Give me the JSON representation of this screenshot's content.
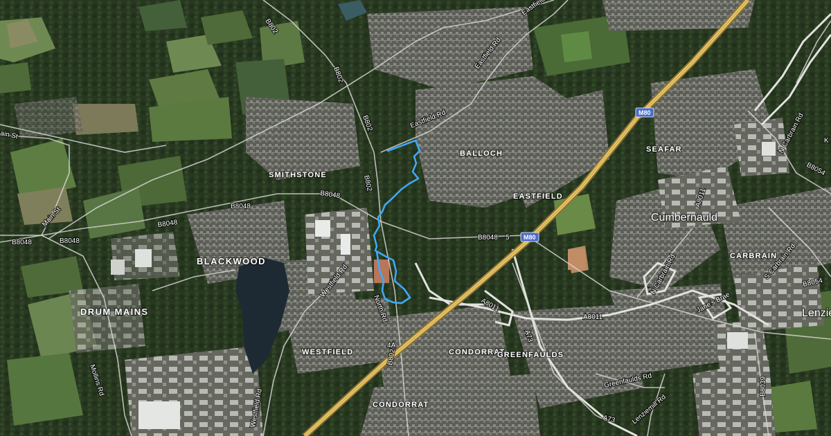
{
  "map": {
    "type": "satellite",
    "colors": {
      "background": "#2f3d27",
      "field": "#4f6b39",
      "field_light": "#6e8a52",
      "forest": "#22321c",
      "urban": "#6f706a",
      "motorway": "#e8c568",
      "road": "#d6d6d2",
      "route": "#3fa9f5",
      "water": "#1e2a33"
    },
    "places": [
      {
        "id": "balloch",
        "label": "BALLOCH"
      },
      {
        "id": "smithstone",
        "label": "SMITHSTONE"
      },
      {
        "id": "eastfield",
        "label": "EASTFIELD"
      },
      {
        "id": "seafar",
        "label": "SEAFAR"
      },
      {
        "id": "blackwood",
        "label": "BLACKWOOD"
      },
      {
        "id": "drum_mains",
        "label": "DRUM MAINS"
      },
      {
        "id": "westfield",
        "label": "WESTFIELD"
      },
      {
        "id": "condorrat_a",
        "label": "CONDORRAT"
      },
      {
        "id": "condorrat_b",
        "label": "CONDORRAT"
      },
      {
        "id": "greenfaulds",
        "label": "GREENFAULDS"
      },
      {
        "id": "carbrain",
        "label": "CARBRAIN"
      },
      {
        "id": "cumbernauld",
        "label": "Cumbernauld"
      },
      {
        "id": "lenzie",
        "label": "Lenzie"
      }
    ],
    "roads": [
      {
        "id": "b802_top",
        "label": "B802"
      },
      {
        "id": "b802_a",
        "label": "B802"
      },
      {
        "id": "b802_b",
        "label": "B802"
      },
      {
        "id": "b802_c",
        "label": "B802"
      },
      {
        "id": "b802_d",
        "label": "B802"
      },
      {
        "id": "eastfield_rd_a",
        "label": "Eastfield Rd"
      },
      {
        "id": "eastfield_rd_b",
        "label": "Eastfield Rd"
      },
      {
        "id": "eastfield_rd_c",
        "label": "Eastfield Rd"
      },
      {
        "id": "b8048_a",
        "label": "B8048"
      },
      {
        "id": "b8048_b",
        "label": "B8048"
      },
      {
        "id": "b8048_c",
        "label": "B8048"
      },
      {
        "id": "b8048_d",
        "label": "B8048"
      },
      {
        "id": "b8048_e",
        "label": "B8048"
      },
      {
        "id": "b8048_f",
        "label": "B8048"
      },
      {
        "id": "main_st_a",
        "label": "Main St"
      },
      {
        "id": "main_st_b",
        "label": "ain St"
      },
      {
        "id": "westfield_rd_a",
        "label": "Westfield Rd"
      },
      {
        "id": "westfield_rd_b",
        "label": "Westfield Rd"
      },
      {
        "id": "north_rd",
        "label": "North Rd"
      },
      {
        "id": "mollins_rd",
        "label": "Mollins Rd"
      },
      {
        "id": "a8011_a",
        "label": "A8011"
      },
      {
        "id": "a8011_b",
        "label": "A8011"
      },
      {
        "id": "a8011_c",
        "label": "A8011"
      },
      {
        "id": "a73_a",
        "label": "A73"
      },
      {
        "id": "a73_b",
        "label": "A73"
      },
      {
        "id": "greenfaulds_rd",
        "label": "Greenfaulds Rd"
      },
      {
        "id": "lenziemill_rd",
        "label": "Lenziemill Rd"
      },
      {
        "id": "n_carbrain_rd_a",
        "label": "N Carbrain Rd"
      },
      {
        "id": "n_carbrain_rd_b",
        "label": "N Carbrain Rd"
      },
      {
        "id": "s_carbrain_rd",
        "label": "S Carbrain Rd"
      },
      {
        "id": "janes_brae",
        "label": "Jane's Brae"
      },
      {
        "id": "b8054_a",
        "label": "B8054"
      },
      {
        "id": "b8054_b",
        "label": "B8054"
      },
      {
        "id": "b8039",
        "label": "B8039"
      },
      {
        "id": "edge_k",
        "label": "K"
      }
    ],
    "shields": [
      {
        "id": "m80_a",
        "label": "M80"
      },
      {
        "id": "m80_b",
        "label": "M80"
      }
    ],
    "junctions": [
      {
        "id": "j5",
        "label": "5"
      },
      {
        "id": "j4a",
        "label": "4A"
      }
    ]
  }
}
